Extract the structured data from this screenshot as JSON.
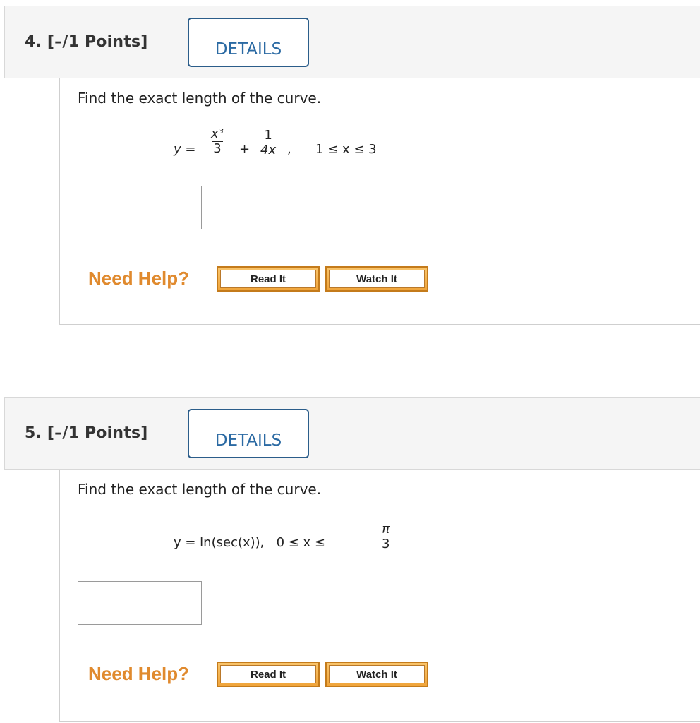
{
  "questions": [
    {
      "title": "4. [–/1 Points]",
      "details_label": "DETAILS",
      "prompt": "Find the exact length of the curve.",
      "eq": {
        "lhs": "y =",
        "f1_num": "x³",
        "f1_den": "3",
        "plus": "+",
        "f2_num": "1",
        "f2_den": "4x",
        "comma": ",",
        "range": "1 ≤ x ≤ 3"
      },
      "answer_value": "",
      "need_help": "Need Help?",
      "read_it": "Read It",
      "watch_it": "Watch It"
    },
    {
      "title": "5. [–/1 Points]",
      "details_label": "DETAILS",
      "prompt": "Find the exact length of the curve.",
      "eq": {
        "expr": "y = ln(sec(x)),   0 ≤ x ≤",
        "pi_num": "π",
        "pi_den": "3"
      },
      "answer_value": "",
      "need_help": "Need Help?",
      "read_it": "Read It",
      "watch_it": "Watch It"
    }
  ],
  "colors": {
    "details_border": "#2b5d8a",
    "details_text": "#2b6aa3",
    "need_help": "#e08a2e",
    "help_button": "#f0a53b"
  }
}
